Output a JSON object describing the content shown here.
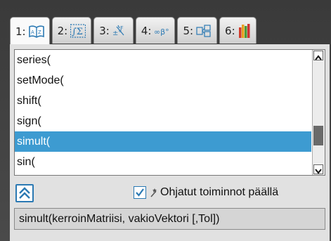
{
  "tabs": [
    {
      "num": "1:",
      "icon": "catalog-book-icon"
    },
    {
      "num": "2:",
      "icon": "math-templates-icon"
    },
    {
      "num": "3:",
      "icon": "symbols-icon"
    },
    {
      "num": "4:",
      "icon": "math-operators-icon"
    },
    {
      "num": "5:",
      "icon": "library-icon"
    },
    {
      "num": "6:",
      "icon": "units-icon"
    }
  ],
  "list": {
    "items": [
      "series(",
      "setMode(",
      "shift(",
      "sign(",
      "simult(",
      "sin("
    ],
    "selected_index": 4
  },
  "options": {
    "wizard_label": "Ohjatut toiminnot päällä",
    "wizard_checked": true
  },
  "help": {
    "syntax": "simult(kerroinMatriisi, vakioVektori [,Tol])"
  },
  "colors": {
    "selection": "#3d9bd1",
    "accent": "#2b79b3"
  }
}
